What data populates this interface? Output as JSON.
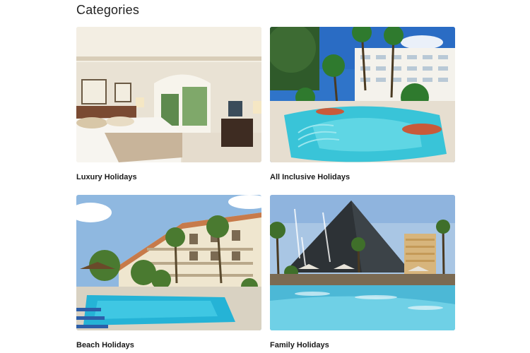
{
  "page": {
    "title": "Categories"
  },
  "categories": [
    {
      "label": "Luxury Holidays",
      "image": "luxury-bedroom-photo"
    },
    {
      "label": "All Inclusive Holidays",
      "image": "resort-pool-photo"
    },
    {
      "label": "Beach Holidays",
      "image": "beach-hotel-pool-photo"
    },
    {
      "label": "Family Holidays",
      "image": "pyramid-hotel-pool-photo"
    }
  ]
}
